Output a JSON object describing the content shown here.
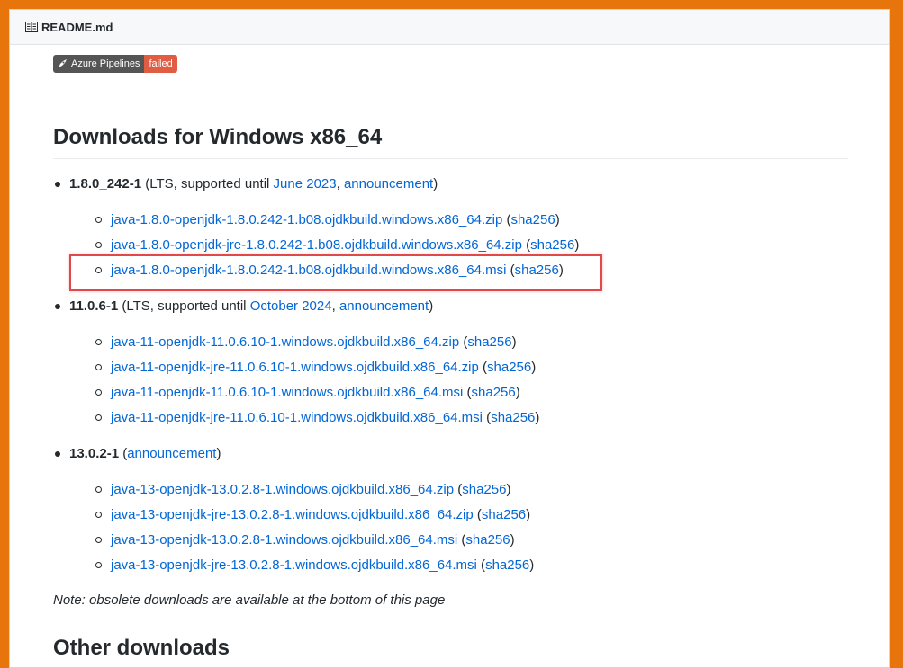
{
  "header": {
    "title": "README.md"
  },
  "badge": {
    "label": "Azure Pipelines",
    "status": "failed",
    "label_color": "#555555",
    "status_color": "#e05d44"
  },
  "section_title": "Downloads for Windows x86_64",
  "releases": [
    {
      "version": "1.8.0_242-1",
      "open": " (LTS, supported until ",
      "until_link": "June 2023",
      "sep": ", ",
      "announcement": "announcement",
      "close": ")",
      "files": [
        {
          "name": "java-1.8.0-openjdk-1.8.0.242-1.b08.ojdkbuild.windows.x86_64.zip",
          "sha": "sha256"
        },
        {
          "name": "java-1.8.0-openjdk-jre-1.8.0.242-1.b08.ojdkbuild.windows.x86_64.zip",
          "sha": "sha256"
        },
        {
          "name": "java-1.8.0-openjdk-1.8.0.242-1.b08.ojdkbuild.windows.x86_64.msi",
          "sha": "sha256"
        }
      ]
    },
    {
      "version": "11.0.6-1",
      "open": " (LTS, supported until ",
      "until_link": "October 2024",
      "sep": ", ",
      "announcement": "announcement",
      "close": ")",
      "files": [
        {
          "name": "java-11-openjdk-11.0.6.10-1.windows.ojdkbuild.x86_64.zip",
          "sha": "sha256"
        },
        {
          "name": "java-11-openjdk-jre-11.0.6.10-1.windows.ojdkbuild.x86_64.zip",
          "sha": "sha256"
        },
        {
          "name": "java-11-openjdk-11.0.6.10-1.windows.ojdkbuild.x86_64.msi",
          "sha": "sha256"
        },
        {
          "name": "java-11-openjdk-jre-11.0.6.10-1.windows.ojdkbuild.x86_64.msi",
          "sha": "sha256"
        }
      ]
    },
    {
      "version": "13.0.2-1",
      "open": " (",
      "announcement": "announcement",
      "close": ")",
      "files": [
        {
          "name": "java-13-openjdk-13.0.2.8-1.windows.ojdkbuild.x86_64.zip",
          "sha": "sha256"
        },
        {
          "name": "java-13-openjdk-jre-13.0.2.8-1.windows.ojdkbuild.x86_64.zip",
          "sha": "sha256"
        },
        {
          "name": "java-13-openjdk-13.0.2.8-1.windows.ojdkbuild.x86_64.msi",
          "sha": "sha256"
        },
        {
          "name": "java-13-openjdk-jre-13.0.2.8-1.windows.ojdkbuild.x86_64.msi",
          "sha": "sha256"
        }
      ]
    }
  ],
  "note": "Note: obsolete downloads are available at the bottom of this page",
  "other_title": "Other downloads",
  "colors": {
    "frame_border": "#e8740c",
    "link": "#0366d6",
    "highlight": "#e0484a"
  }
}
